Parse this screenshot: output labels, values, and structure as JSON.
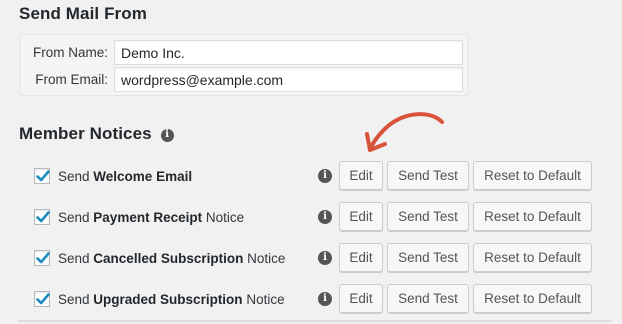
{
  "send_mail": {
    "title": "Send Mail From",
    "from_name_label": "From Name:",
    "from_name_value": "Demo Inc.",
    "from_email_label": "From Email:",
    "from_email_value": "wordpress@example.com"
  },
  "member_notices": {
    "title": "Member Notices",
    "title_icon": "info-icon",
    "rows": [
      {
        "checked": true,
        "prefix": "Send",
        "bold": "Welcome Email",
        "suffix": ""
      },
      {
        "checked": true,
        "prefix": "Send",
        "bold": "Payment Receipt",
        "suffix": "Notice"
      },
      {
        "checked": true,
        "prefix": "Send",
        "bold": "Cancelled Subscription",
        "suffix": "Notice"
      },
      {
        "checked": true,
        "prefix": "Send",
        "bold": "Upgraded Subscription",
        "suffix": "Notice"
      }
    ],
    "buttons": {
      "edit": "Edit",
      "send_test": "Send Test",
      "reset": "Reset to Default"
    }
  },
  "colors": {
    "accent_check": "#1e8cbe",
    "annotation_arrow": "#d9533b"
  }
}
